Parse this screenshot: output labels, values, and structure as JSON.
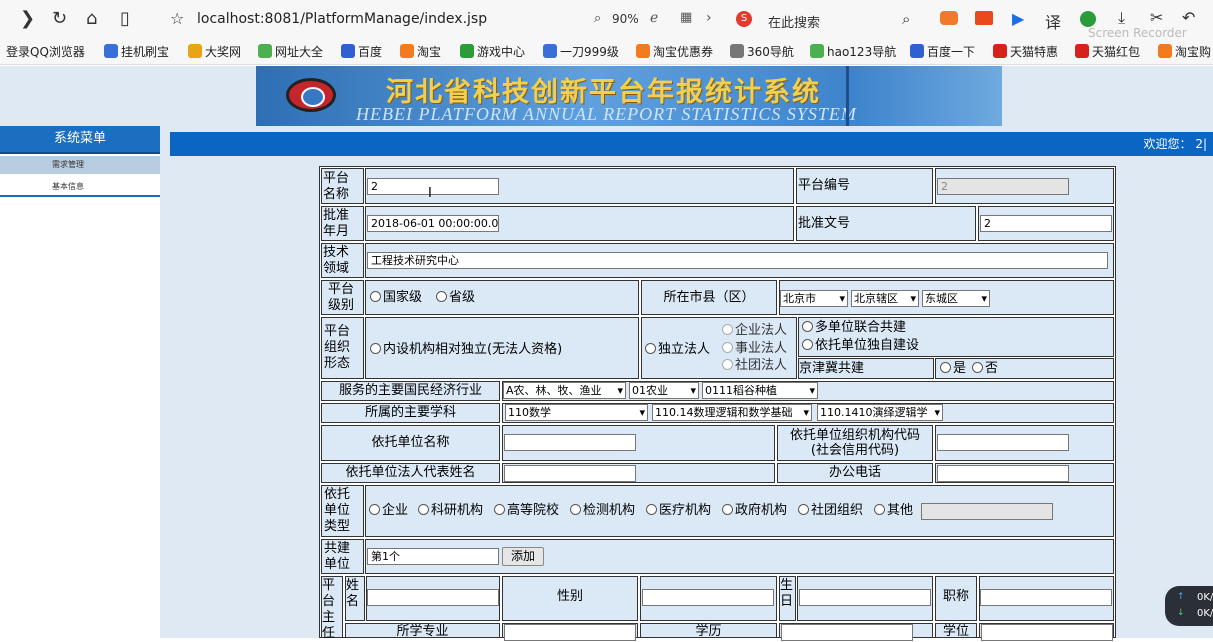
{
  "browser": {
    "url": "localhost:8081/PlatformManage/index.jsp",
    "zoom": "90%",
    "search_label": "在此搜索",
    "recorder": "Screen Recorder"
  },
  "bookmarks": [
    {
      "label": "登录QQ浏览器",
      "icon": "none"
    },
    {
      "label": "挂机刷宝",
      "icon": "game-icon"
    },
    {
      "label": "大奖网",
      "icon": "lottery-icon"
    },
    {
      "label": "网址大全",
      "icon": "hao-icon"
    },
    {
      "label": "百度",
      "icon": "baidu-icon"
    },
    {
      "label": "淘宝",
      "icon": "taobao-icon"
    },
    {
      "label": "游戏中心",
      "icon": "gamepad-icon"
    },
    {
      "label": "一刀999级",
      "icon": "game-icon"
    },
    {
      "label": "淘宝优惠券",
      "icon": "taobao-icon"
    },
    {
      "label": "360导航",
      "icon": "globe-icon"
    },
    {
      "label": "hao123导航",
      "icon": "hao-icon"
    },
    {
      "label": "百度一下",
      "icon": "baidu-icon"
    },
    {
      "label": "天猫特惠",
      "icon": "tmall-icon"
    },
    {
      "label": "天猫红包",
      "icon": "tmall-icon"
    },
    {
      "label": "淘宝购",
      "icon": "taobao-icon"
    }
  ],
  "banner": {
    "title_cn": "河北省科技创新平台年报统计系统",
    "title_en": "HEBEI PLATFORM ANNUAL REPORT STATISTICS SYSTEM"
  },
  "nav": {
    "header": "系统菜单",
    "items": [
      "需求管理",
      "基本信息"
    ]
  },
  "welcome": "欢迎您： 2|",
  "form": {
    "platform_name_label": "平台名称",
    "platform_name_value": "2",
    "platform_no_label": "平台编号",
    "platform_no_value": "2",
    "approve_date_label": "批准年月",
    "approve_date_value": "2018-06-01 00:00:00.0",
    "approve_doc_label": "批准文号",
    "approve_doc_value": "2",
    "tech_field_label": "技术领域",
    "tech_field_value": "工程技术研究中心",
    "level_label": "平台级别",
    "level_options": [
      "国家级",
      "省级"
    ],
    "city_label": "所在市县（区）",
    "city_selects": [
      "北京市",
      "北京辖区",
      "东城区"
    ],
    "org_form_label": "平台组织形态",
    "org_form_internal": "内设机构相对独立(无法人资格)",
    "org_form_independent": "独立法人",
    "legal_types": [
      "企业法人",
      "事业法人",
      "社团法人"
    ],
    "build_types": [
      "多单位联合共建",
      "依托单位独自建设"
    ],
    "jjj_label": "京津冀共建",
    "jjj_options": [
      "是",
      "否"
    ],
    "industry_label": "服务的主要国民经济行业",
    "industry_selects": [
      "A农、林、牧、渔业",
      "01农业",
      "0111稻谷种植"
    ],
    "discipline_label": "所属的主要学科",
    "discipline_selects": [
      "110数学",
      "110.14数理逻辑和数学基础",
      "110.1410演绎逻辑学"
    ],
    "host_name_label": "依托单位名称",
    "host_code_label": "依托单位组织机构代码(社会信用代码)",
    "host_code_line1": "依托单位组织机构代码",
    "host_code_line2": "(社会信用代码)",
    "legal_rep_label": "依托单位法人代表姓名",
    "office_phone_label": "办公电话",
    "host_type_label": "依托单位类型",
    "host_types": [
      "企业",
      "科研机构",
      "高等院校",
      "检测机构",
      "医疗机构",
      "政府机构",
      "社团组织",
      "其他"
    ],
    "cobuild_label": "共建单位",
    "cobuild_value": "第1个",
    "add_button": "添加",
    "director_label": "平台主任",
    "name_label": "姓名",
    "gender_label": "性别",
    "birth_label": "生日",
    "title_label": "职称",
    "major_label": "所学专业",
    "education_label": "学历",
    "degree_label": "学位"
  },
  "speed_widget": [
    "0K/",
    "0K/"
  ]
}
